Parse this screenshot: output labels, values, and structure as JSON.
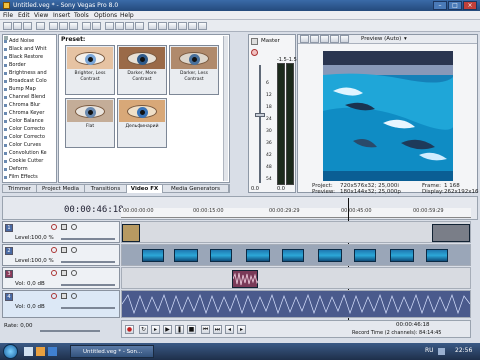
{
  "window": {
    "title": "Untitled.veg * - Sony Vegas Pro 8.0"
  },
  "menu": [
    "File",
    "Edit",
    "View",
    "Insert",
    "Tools",
    "Options",
    "Help"
  ],
  "fx_list": [
    "Add Noise",
    "Black and Whit",
    "Black Restore",
    "Border",
    "Brightness and",
    "Broadcast Colo",
    "Bump Map",
    "Channel Blend",
    "Chroma Blur",
    "Chroma Keyer",
    "Color Balance",
    "Color Correcto",
    "Color Correcto",
    "Color Curves",
    "Convolution Ke",
    "Cookie Cutter",
    "Deform",
    "Film Effects"
  ],
  "presets": {
    "label": "Preset:",
    "items": [
      "Brighter, Less Contrast",
      "Darker, More Contrast",
      "Darker, Less Contrast",
      "Flat",
      "Дельфинарий"
    ]
  },
  "tabs": [
    "Trimmer",
    "Project Media",
    "Transitions",
    "Video FX",
    "Media Generators"
  ],
  "active_tab": "Video FX",
  "mixer": {
    "master": "Master",
    "scale": [
      "-1.5",
      "-1.5",
      "6",
      "12",
      "18",
      "24",
      "30",
      "36",
      "42",
      "48",
      "54",
      "0.0",
      "0.0"
    ]
  },
  "preview": {
    "mode": "Preview (Auto)",
    "project_label": "Project:",
    "project_value": "720x576x32; 25,000i",
    "preview_label": "Preview:",
    "preview_value": "180x144x32; 25,000p",
    "frame_label": "Frame:",
    "frame_value": "1 168",
    "display_label": "Display:",
    "display_value": "262x192x16"
  },
  "timeline": {
    "timecode": "00:00:46:18",
    "ruler": [
      "00:00:00:00",
      "00:00:15:00",
      "00:00:29:29",
      "00:00:45:00",
      "00:00:59:29"
    ],
    "tracks": [
      {
        "num": "1",
        "label": "Level:",
        "value": "100,0 %"
      },
      {
        "num": "2",
        "label": "Level:",
        "value": "100,0 %"
      },
      {
        "num": "3",
        "label": "Vol:",
        "value": "0,0 dB"
      },
      {
        "num": "4",
        "label": "Vol:",
        "value": "0,0 dB"
      }
    ],
    "rate_label": "Rate: 0,00",
    "cursor_time": "00:00:46:18",
    "record_time": "Record Time (2 channels): 84:14:45"
  },
  "taskbar": {
    "task": "Untitled.veg * - Son...",
    "lang": "RU",
    "clock": "22:56"
  },
  "colors": {
    "title_bar": "#2d5a96",
    "accent": "#2f5a8c",
    "taskbar": "#1e2f4a"
  }
}
